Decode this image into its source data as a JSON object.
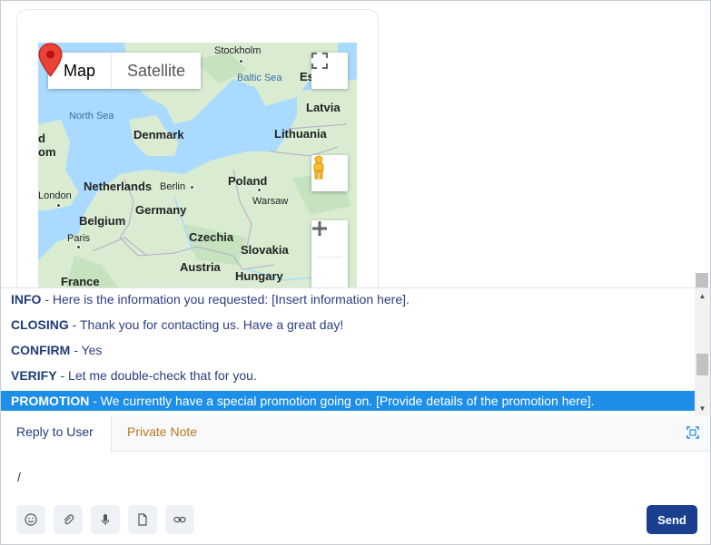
{
  "map": {
    "type_buttons": [
      "Map",
      "Satellite"
    ],
    "labels": {
      "stockholm": "Stockholm",
      "baltic_sea": "Baltic Sea",
      "es": "Es",
      "north_sea": "North Sea",
      "latvia": "Latvia",
      "denmark": "Denmark",
      "lithuania": "Lithuania",
      "d": "d",
      "om": "om",
      "netherlands": "Netherlands",
      "berlin": "Berlin",
      "poland": "Poland",
      "london": "London",
      "warsaw": "Warsaw",
      "belgium": "Belgium",
      "germany": "Germany",
      "paris": "Paris",
      "czechia": "Czechia",
      "slovakia": "Slovakia",
      "austria": "Austria",
      "hungary": "Hungary",
      "france": "France"
    },
    "colors": {
      "water": "#aadaff",
      "land": "#d9ecd2",
      "land_dark": "#c6e2bf",
      "pin": "#ea4335"
    }
  },
  "canned_responses": [
    {
      "key": "INFO",
      "text": "Here is the information you requested: [Insert information here]."
    },
    {
      "key": "CLOSING",
      "text": "Thank you for contacting us. Have a great day!"
    },
    {
      "key": "CONFIRM",
      "text": "Yes"
    },
    {
      "key": "VERIFY",
      "text": "Let me double-check that for you."
    },
    {
      "key": "PROMOTION",
      "text": "We currently have a special promotion going on. [Provide details of the promotion here]."
    }
  ],
  "separator": " - ",
  "reply": {
    "tabs": [
      "Reply to User",
      "Private Note"
    ],
    "input_value": "/",
    "send_label": "Send"
  },
  "icons": [
    "emoji-icon",
    "attachment-icon",
    "microphone-icon",
    "document-icon",
    "link-icon",
    "expand-icon",
    "fullscreen-icon",
    "pegman-icon"
  ]
}
